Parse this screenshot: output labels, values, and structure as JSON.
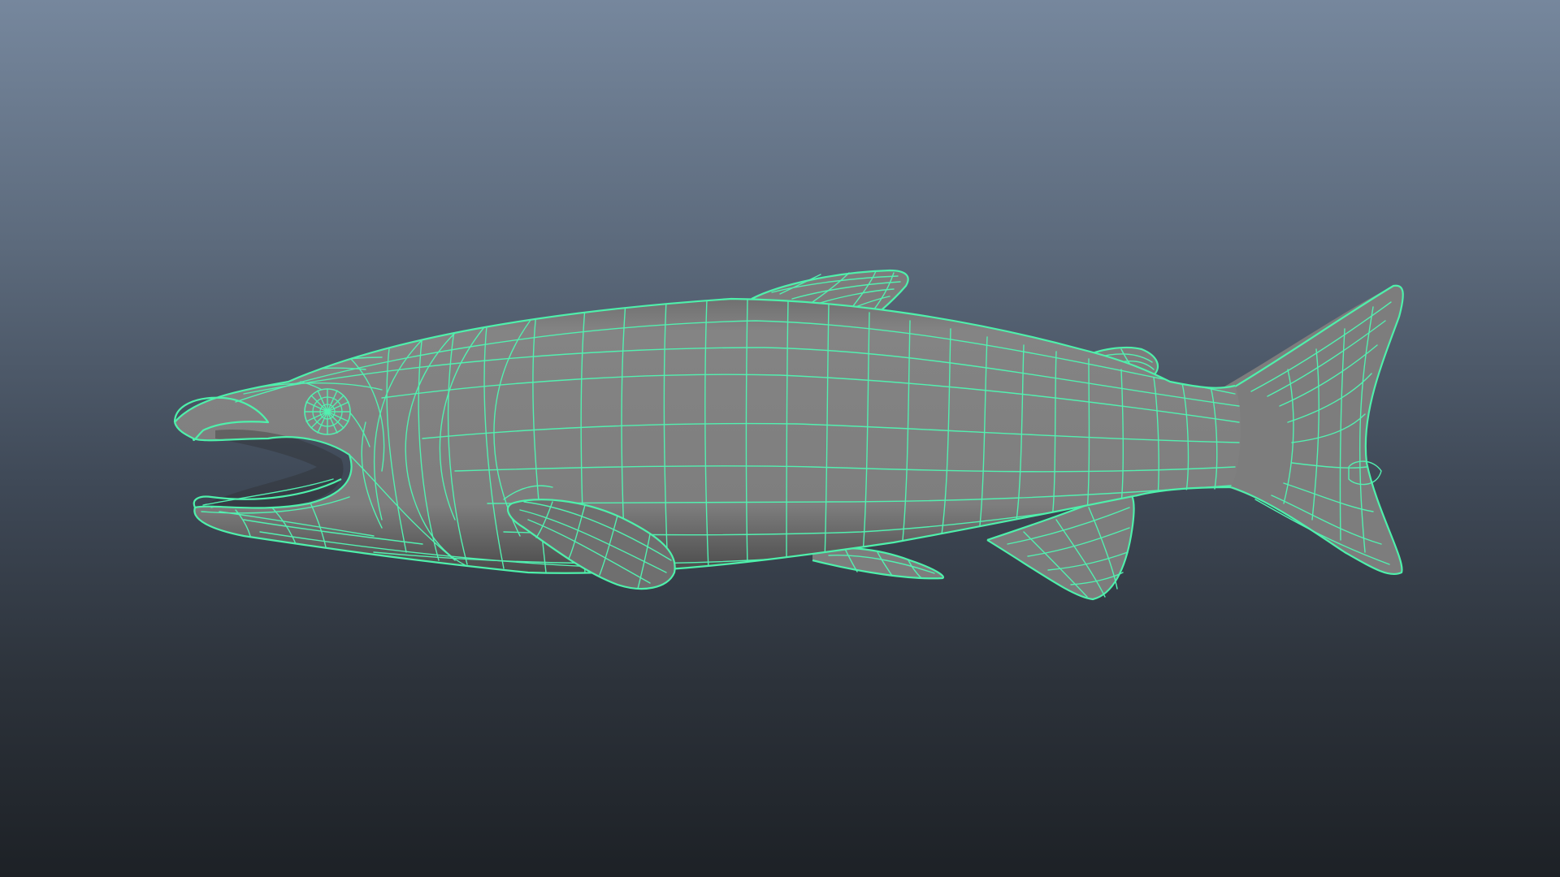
{
  "viewport": {
    "background_top": "#76879d",
    "background_bottom": "#1d2126",
    "wireframe_color": "#52f0b0",
    "shaded_surface_color": "#7d7d7d"
  },
  "model": {
    "subject": "salmon",
    "display_mode": "wireframe-on-shaded"
  }
}
